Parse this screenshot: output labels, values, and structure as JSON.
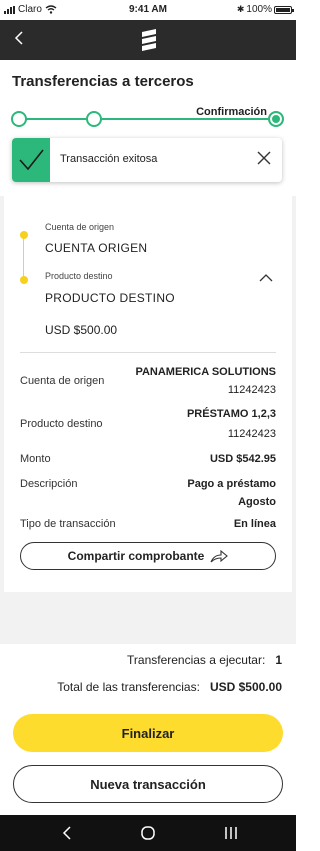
{
  "status_bar": {
    "carrier": "Claro",
    "time": "9:41 AM",
    "battery": "100%"
  },
  "app_bar": {
    "back_icon": "chevron-left-icon",
    "logo_icon": "bank-logo-icon"
  },
  "page": {
    "title": "Transferencias a terceros"
  },
  "stepper": {
    "steps": [
      "",
      "",
      "Confirmación"
    ],
    "active_step": 3,
    "accent_color": "#2cb87a"
  },
  "toast": {
    "message": "Transacción exitosa",
    "icon": "checkmark-icon",
    "close_icon": "close-icon"
  },
  "origin": {
    "label": "Cuenta de origen",
    "value": "CUENTA ORIGEN"
  },
  "destination": {
    "label": "Producto destino",
    "value": "PRODUCTO DESTINO",
    "amount": "USD $500.00"
  },
  "details": {
    "rows": [
      {
        "label": "Cuenta de origen",
        "value_line1": "PANAMERICA SOLUTIONS",
        "value_line2": "11242423"
      },
      {
        "label": "Producto destino",
        "value_line1": "PRÉSTAMO 1,2,3",
        "value_line2": "11242423"
      },
      {
        "label": "Monto",
        "value_line1": "USD $542.95"
      },
      {
        "label": "Descripción",
        "value_line1": "Pago a préstamo",
        "value_line2": "Agosto"
      },
      {
        "label": "Tipo de transacción",
        "value_line1": "En línea"
      }
    ],
    "share_button": "Compartir comprobante"
  },
  "summary": {
    "transfers_label": "Transferencias a ejecutar:",
    "transfers_value": "1",
    "total_label": "Total de las transferencias:",
    "total_value": "USD $500.00"
  },
  "actions": {
    "finish": "Finalizar",
    "new_transaction": "Nueva transacción",
    "primary_color": "#fddc2e"
  },
  "nav_bar": {
    "items": [
      "back-icon",
      "home-icon",
      "recent-apps-icon"
    ]
  }
}
